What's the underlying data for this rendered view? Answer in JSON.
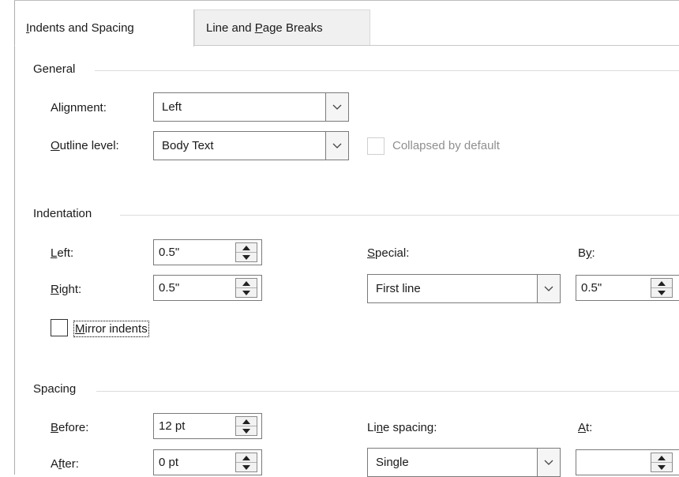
{
  "tabs": [
    {
      "label": "Indents and Spacing",
      "active": true
    },
    {
      "label": "Line and Page Breaks",
      "active": false
    }
  ],
  "general": {
    "title": "General",
    "alignment": {
      "label": "Alignment:",
      "value": "Left"
    },
    "outline_level": {
      "label": "Outline level:",
      "value": "Body Text"
    },
    "collapsed": {
      "label": "Collapsed by default",
      "checked": false,
      "enabled": false
    }
  },
  "indentation": {
    "title": "Indentation",
    "left": {
      "label": "Left:",
      "value": "0.5\""
    },
    "right": {
      "label": "Right:",
      "value": "0.5\""
    },
    "special": {
      "label": "Special:",
      "value": "First line"
    },
    "by": {
      "label": "By:",
      "value": "0.5\""
    },
    "mirror": {
      "label": "Mirror indents",
      "checked": false
    }
  },
  "spacing": {
    "title": "Spacing",
    "before": {
      "label": "Before:",
      "value": "12 pt"
    },
    "after": {
      "label": "After:",
      "value": "0 pt"
    },
    "line_spacing": {
      "label": "Line spacing:",
      "value": "Single"
    },
    "at": {
      "label": "At:",
      "value": ""
    }
  }
}
